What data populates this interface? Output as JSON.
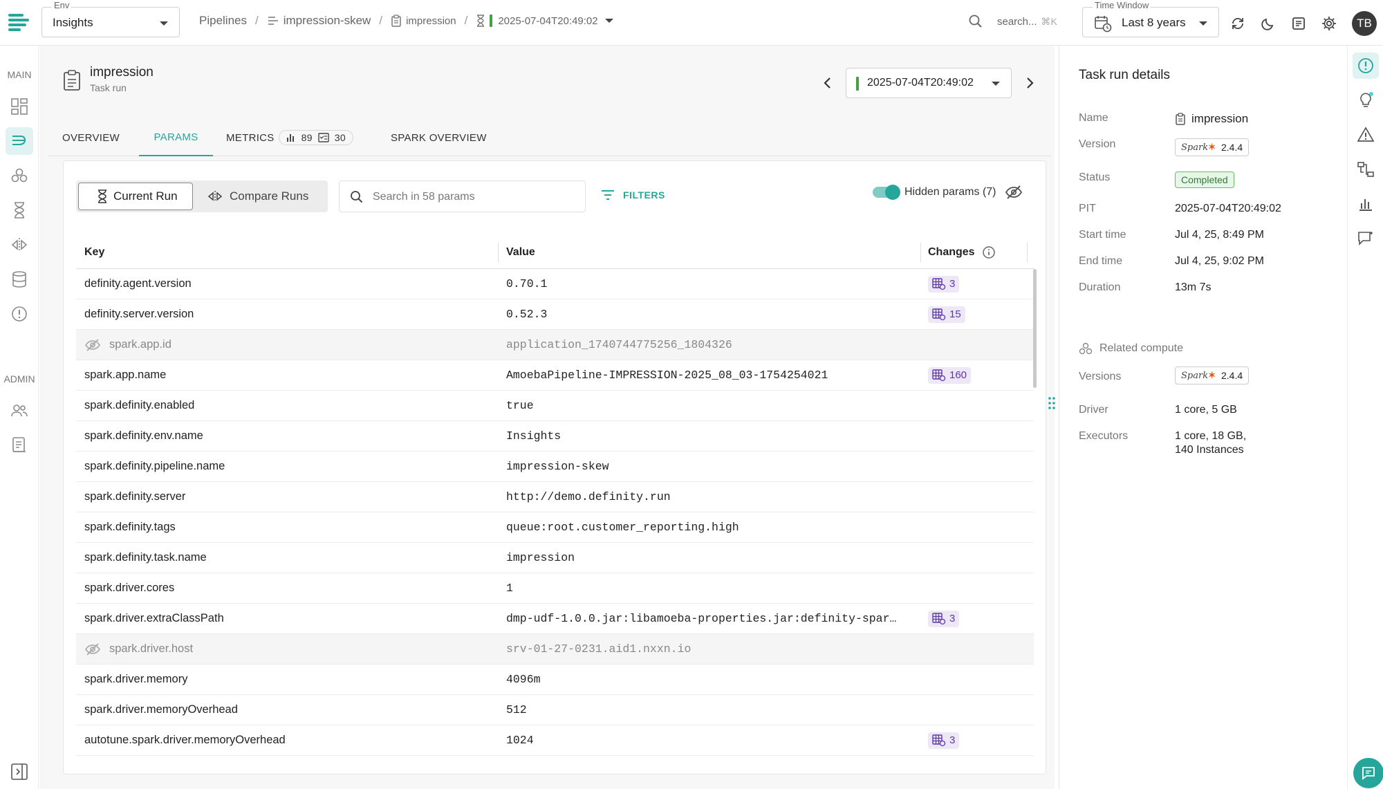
{
  "topbar": {
    "env_label": "Env",
    "env_value": "Insights",
    "breadcrumb": [
      "Pipelines",
      "impression-skew",
      "impression",
      "2025-07-04T20:49:02"
    ],
    "search_text": "search...",
    "search_shortcut": "⌘K",
    "time_window_label": "Time Window",
    "time_window_value": "Last 8 years",
    "avatar_initials": "TB"
  },
  "nav": {
    "main_label": "MAIN",
    "admin_label": "ADMIN"
  },
  "page": {
    "title": "impression",
    "subtitle": "Task run",
    "run_value": "2025-07-04T20:49:02"
  },
  "tabs": {
    "overview": "OVERVIEW",
    "params": "PARAMS",
    "metrics": "METRICS",
    "metrics_count_a": "89",
    "metrics_count_b": "30",
    "spark_overview": "SPARK OVERVIEW"
  },
  "params": {
    "current_run": "Current Run",
    "compare_runs": "Compare Runs",
    "search_placeholder": "Search in 58 params",
    "filters": "FILTERS",
    "hidden_params": "Hidden params (7)",
    "columns": {
      "key": "Key",
      "value": "Value",
      "changes": "Changes"
    },
    "rows": [
      {
        "key": "definity.agent.version",
        "value": "0.70.1",
        "changes": "3",
        "hidden": false
      },
      {
        "key": "definity.server.version",
        "value": "0.52.3",
        "changes": "15",
        "hidden": false
      },
      {
        "key": "spark.app.id",
        "value": "application_1740744775256_1804326",
        "changes": "",
        "hidden": true
      },
      {
        "key": "spark.app.name",
        "value": "AmoebaPipeline-IMPRESSION-2025_08_03-1754254021",
        "changes": "160",
        "hidden": false
      },
      {
        "key": "spark.definity.enabled",
        "value": "true",
        "changes": "",
        "hidden": false
      },
      {
        "key": "spark.definity.env.name",
        "value": "Insights",
        "changes": "",
        "hidden": false
      },
      {
        "key": "spark.definity.pipeline.name",
        "value": "impression-skew",
        "changes": "",
        "hidden": false
      },
      {
        "key": "spark.definity.server",
        "value": "http://demo.definity.run",
        "changes": "",
        "hidden": false
      },
      {
        "key": "spark.definity.tags",
        "value": "queue:root.customer_reporting.high",
        "changes": "",
        "hidden": false
      },
      {
        "key": "spark.definity.task.name",
        "value": "impression",
        "changes": "",
        "hidden": false
      },
      {
        "key": "spark.driver.cores",
        "value": "1",
        "changes": "",
        "hidden": false
      },
      {
        "key": "spark.driver.extraClassPath",
        "value": "dmp-udf-1.0.0.jar:libamoeba-properties.jar:definity-spar…",
        "changes": "3",
        "hidden": false
      },
      {
        "key": "spark.driver.host",
        "value": "srv-01-27-0231.aid1.nxxn.io",
        "changes": "",
        "hidden": true
      },
      {
        "key": "spark.driver.memory",
        "value": "4096m",
        "changes": "",
        "hidden": false
      },
      {
        "key": "spark.driver.memoryOverhead",
        "value": "512",
        "changes": "",
        "hidden": false
      },
      {
        "key": "autotune.spark.driver.memoryOverhead",
        "value": "1024",
        "changes": "3",
        "hidden": false
      }
    ]
  },
  "details": {
    "title": "Task run details",
    "name_label": "Name",
    "name_value": "impression",
    "version_label": "Version",
    "version_value": "2.4.4",
    "spark_logo_text": "Spark",
    "status_label": "Status",
    "status_value": "Completed",
    "pit_label": "PIT",
    "pit_value": "2025-07-04T20:49:02",
    "start_label": "Start time",
    "start_value": "Jul 4, 25, 8:49 PM",
    "end_label": "End time",
    "end_value": "Jul 4, 25, 9:02 PM",
    "duration_label": "Duration",
    "duration_value": "13m 7s",
    "related_compute": "Related compute",
    "versions_label": "Versions",
    "versions_value": "2.4.4",
    "driver_label": "Driver",
    "driver_value": "1 core, 5 GB",
    "executors_label": "Executors",
    "executors_line1": "1 core, 18 GB,",
    "executors_line2": "140 Instances"
  },
  "colors": {
    "accent": "#26a69a",
    "status_green": "#2e7d32",
    "changes_purple": "#5e35b1"
  }
}
